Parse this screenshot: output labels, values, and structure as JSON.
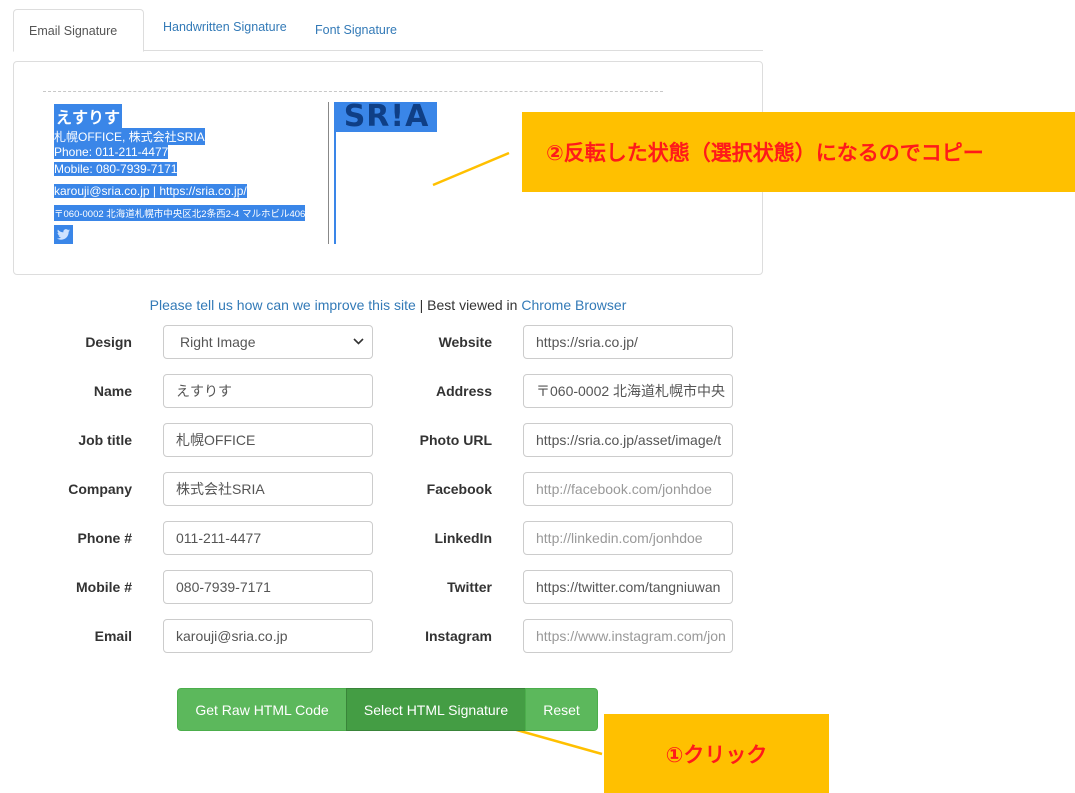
{
  "tabs": [
    {
      "label": "Email Signature"
    },
    {
      "label": "Handwritten Signature"
    },
    {
      "label": "Font Signature"
    }
  ],
  "preview": {
    "name": "えすりす",
    "line1": "札幌OFFICE, 株式会社SRIA",
    "line2": "Phone: 011-211-4477",
    "line3": "Mobile: 080-7939-7171",
    "line4": "karouji@sria.co.jp | https://sria.co.jp/",
    "line5": "〒060-0002 北海道札幌市中央区北2条西2-4 マルホビル406",
    "logo_text": "SR!A",
    "selection_color": "#3a86e8"
  },
  "feedback": {
    "link_text": "Please tell us how can we improve this site",
    "separator": " | Best viewed in ",
    "browser_link": "Chrome Browser"
  },
  "form": {
    "design_label": "Design",
    "design_value": "Right Image",
    "name_label": "Name",
    "name_value": "えすりす",
    "job_label": "Job title",
    "job_value": "札幌OFFICE",
    "company_label": "Company",
    "company_value": "株式会社SRIA",
    "phone_label": "Phone #",
    "phone_value": "011-211-4477",
    "mobile_label": "Mobile #",
    "mobile_value": "080-7939-7171",
    "email_label": "Email",
    "email_value": "karouji@sria.co.jp",
    "website_label": "Website",
    "website_value": "https://sria.co.jp/",
    "address_label": "Address",
    "address_value": "〒060-0002 北海道札幌市中央",
    "photo_label": "Photo URL",
    "photo_value": "https://sria.co.jp/asset/image/t",
    "facebook_label": "Facebook",
    "facebook_placeholder": "http://facebook.com/jonhdoe",
    "linkedin_label": "LinkedIn",
    "linkedin_placeholder": "http://linkedin.com/jonhdoe",
    "twitter_label": "Twitter",
    "twitter_value": "https://twitter.com/tangniuwan",
    "instagram_label": "Instagram",
    "instagram_placeholder": "https://www.instagram.com/jon"
  },
  "buttons": {
    "raw_html": "Get Raw HTML Code",
    "select_html": "Select HTML Signature",
    "reset": "Reset"
  },
  "annotations": {
    "step1": "①クリック",
    "step2": "②反転した状態（選択状態）になるのでコピー",
    "color": "#ffc000",
    "text_color": "#ff1a1a"
  }
}
